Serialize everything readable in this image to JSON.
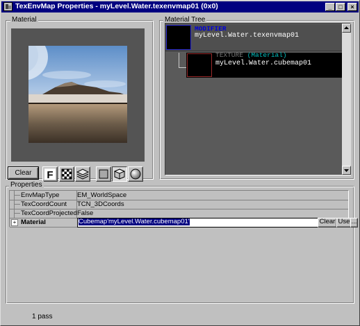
{
  "window": {
    "title": "TexEnvMap Properties - myLevel.Water.texenvmap01 (0x0)",
    "controls": [
      "_",
      "□",
      "×"
    ]
  },
  "material_group": {
    "label": "Material"
  },
  "material_tree": {
    "label": "Material Tree",
    "nodes": [
      {
        "kind": "MODIFIER",
        "name": "myLevel.Water.texenvmap01",
        "selected": true
      },
      {
        "kind": "TEXTURE",
        "kind_suffix": "(Material)",
        "name": "myLevel.Water.cubemap01",
        "selected": false
      }
    ]
  },
  "toolbar": {
    "clear_label": "Clear",
    "icons": [
      "bold-f-icon",
      "checker-icon",
      "layers-icon",
      "plane-icon",
      "cube-icon",
      "sphere-icon"
    ]
  },
  "properties": {
    "label": "Properties",
    "rows": [
      {
        "name": "EnvMapType",
        "value": "EM_WorldSpace"
      },
      {
        "name": "TexCoordCount",
        "value": "TCN_3DCoords"
      },
      {
        "name": "TexCoordProjected",
        "value": "False"
      },
      {
        "name": "Material",
        "value": "Cubemap'myLevel.Water.cubemap01'"
      }
    ],
    "clear_label": "Clear",
    "use_label": "Use",
    "browse_label": "..."
  },
  "status": {
    "text": "1 pass"
  },
  "colors": {
    "titlebar": "#000080",
    "window": "#c0c0c0",
    "tree_bg": "#5a5a5a",
    "modifier_kind": "#0000d8",
    "material_suffix": "#00bcbc"
  }
}
